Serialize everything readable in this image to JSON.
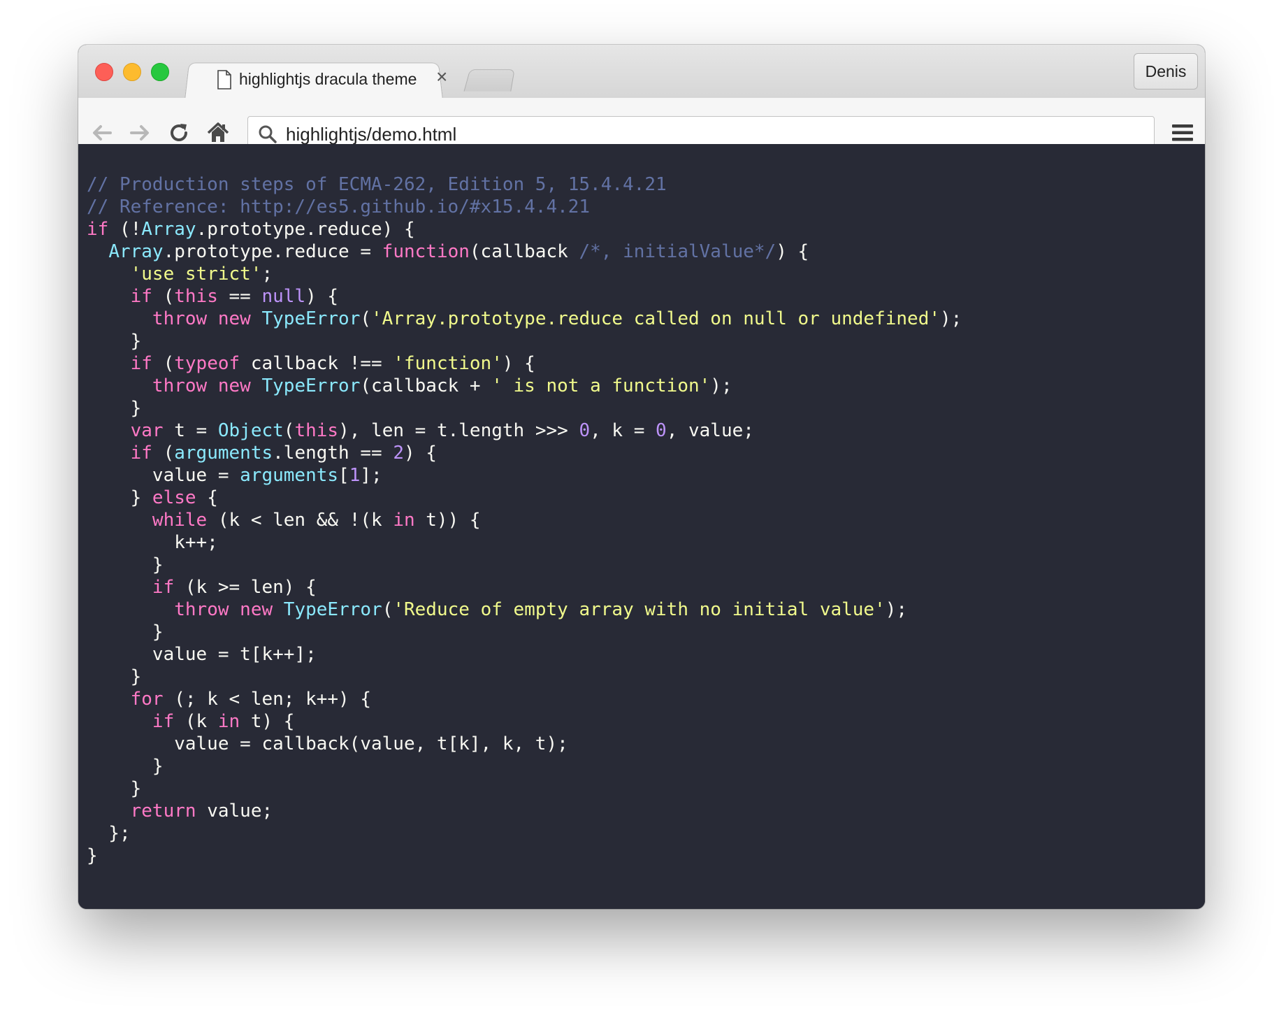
{
  "browser": {
    "tab_title": "highlightjs dracula theme",
    "tab_close": "×",
    "profile_name": "Denis",
    "url": "highlightjs/demo.html",
    "icons": [
      "back-icon",
      "forward-icon",
      "reload-icon",
      "home-icon",
      "search-icon",
      "menu-icon",
      "document-icon",
      "close-icon"
    ]
  },
  "theme": {
    "background": "#282a36",
    "foreground": "#f8f8f2",
    "comment": "#6272a4",
    "keyword": "#ff79c6",
    "builtin": "#8be9fd",
    "string": "#f1fa8c",
    "number": "#bd93f9"
  },
  "code": {
    "lines": [
      [
        [
          "comment",
          "// Production steps of ECMA-262, Edition 5, 15.4.4.21"
        ]
      ],
      [
        [
          "comment",
          "// Reference: http://es5.github.io/#x15.4.4.21"
        ]
      ],
      [
        [
          "keyword",
          "if"
        ],
        [
          "plain",
          " (!"
        ],
        [
          "builtin",
          "Array"
        ],
        [
          "plain",
          ".prototype.reduce) {"
        ]
      ],
      [
        [
          "plain",
          "  "
        ],
        [
          "builtin",
          "Array"
        ],
        [
          "plain",
          ".prototype.reduce = "
        ],
        [
          "keyword",
          "function"
        ],
        [
          "plain",
          "(callback "
        ],
        [
          "comment",
          "/*, initialValue*/"
        ],
        [
          "plain",
          ") {"
        ]
      ],
      [
        [
          "plain",
          "    "
        ],
        [
          "string",
          "'use strict'"
        ],
        [
          "plain",
          ";"
        ]
      ],
      [
        [
          "plain",
          "    "
        ],
        [
          "keyword",
          "if"
        ],
        [
          "plain",
          " ("
        ],
        [
          "keyword",
          "this"
        ],
        [
          "plain",
          " == "
        ],
        [
          "literal",
          "null"
        ],
        [
          "plain",
          ") {"
        ]
      ],
      [
        [
          "plain",
          "      "
        ],
        [
          "keyword",
          "throw"
        ],
        [
          "plain",
          " "
        ],
        [
          "keyword",
          "new"
        ],
        [
          "plain",
          " "
        ],
        [
          "builtin",
          "TypeError"
        ],
        [
          "plain",
          "("
        ],
        [
          "string",
          "'Array.prototype.reduce called on null or undefined'"
        ],
        [
          "plain",
          ");"
        ]
      ],
      [
        [
          "plain",
          "    }"
        ]
      ],
      [
        [
          "plain",
          "    "
        ],
        [
          "keyword",
          "if"
        ],
        [
          "plain",
          " ("
        ],
        [
          "keyword",
          "typeof"
        ],
        [
          "plain",
          " callback !== "
        ],
        [
          "string",
          "'function'"
        ],
        [
          "plain",
          ") {"
        ]
      ],
      [
        [
          "plain",
          "      "
        ],
        [
          "keyword",
          "throw"
        ],
        [
          "plain",
          " "
        ],
        [
          "keyword",
          "new"
        ],
        [
          "plain",
          " "
        ],
        [
          "builtin",
          "TypeError"
        ],
        [
          "plain",
          "(callback + "
        ],
        [
          "string",
          "' is not a function'"
        ],
        [
          "plain",
          ");"
        ]
      ],
      [
        [
          "plain",
          "    }"
        ]
      ],
      [
        [
          "plain",
          "    "
        ],
        [
          "keyword",
          "var"
        ],
        [
          "plain",
          " t = "
        ],
        [
          "builtin",
          "Object"
        ],
        [
          "plain",
          "("
        ],
        [
          "keyword",
          "this"
        ],
        [
          "plain",
          "), len = t.length >>> "
        ],
        [
          "number",
          "0"
        ],
        [
          "plain",
          ", k = "
        ],
        [
          "number",
          "0"
        ],
        [
          "plain",
          ", value;"
        ]
      ],
      [
        [
          "plain",
          "    "
        ],
        [
          "keyword",
          "if"
        ],
        [
          "plain",
          " ("
        ],
        [
          "builtin",
          "arguments"
        ],
        [
          "plain",
          ".length == "
        ],
        [
          "number",
          "2"
        ],
        [
          "plain",
          ") {"
        ]
      ],
      [
        [
          "plain",
          "      value = "
        ],
        [
          "builtin",
          "arguments"
        ],
        [
          "plain",
          "["
        ],
        [
          "number",
          "1"
        ],
        [
          "plain",
          "];"
        ]
      ],
      [
        [
          "plain",
          "    } "
        ],
        [
          "keyword",
          "else"
        ],
        [
          "plain",
          " {"
        ]
      ],
      [
        [
          "plain",
          "      "
        ],
        [
          "keyword",
          "while"
        ],
        [
          "plain",
          " (k < len && !(k "
        ],
        [
          "keyword",
          "in"
        ],
        [
          "plain",
          " t)) {"
        ]
      ],
      [
        [
          "plain",
          "        k++;"
        ]
      ],
      [
        [
          "plain",
          "      }"
        ]
      ],
      [
        [
          "plain",
          "      "
        ],
        [
          "keyword",
          "if"
        ],
        [
          "plain",
          " (k >= len) {"
        ]
      ],
      [
        [
          "plain",
          "        "
        ],
        [
          "keyword",
          "throw"
        ],
        [
          "plain",
          " "
        ],
        [
          "keyword",
          "new"
        ],
        [
          "plain",
          " "
        ],
        [
          "builtin",
          "TypeError"
        ],
        [
          "plain",
          "("
        ],
        [
          "string",
          "'Reduce of empty array with no initial value'"
        ],
        [
          "plain",
          ");"
        ]
      ],
      [
        [
          "plain",
          "      }"
        ]
      ],
      [
        [
          "plain",
          "      value = t[k++];"
        ]
      ],
      [
        [
          "plain",
          "    }"
        ]
      ],
      [
        [
          "plain",
          "    "
        ],
        [
          "keyword",
          "for"
        ],
        [
          "plain",
          " (; k < len; k++) {"
        ]
      ],
      [
        [
          "plain",
          "      "
        ],
        [
          "keyword",
          "if"
        ],
        [
          "plain",
          " (k "
        ],
        [
          "keyword",
          "in"
        ],
        [
          "plain",
          " t) {"
        ]
      ],
      [
        [
          "plain",
          "        value = callback(value, t[k], k, t);"
        ]
      ],
      [
        [
          "plain",
          "      }"
        ]
      ],
      [
        [
          "plain",
          "    }"
        ]
      ],
      [
        [
          "plain",
          "    "
        ],
        [
          "keyword",
          "return"
        ],
        [
          "plain",
          " value;"
        ]
      ],
      [
        [
          "plain",
          "  };"
        ]
      ],
      [
        [
          "plain",
          "}"
        ]
      ]
    ]
  }
}
